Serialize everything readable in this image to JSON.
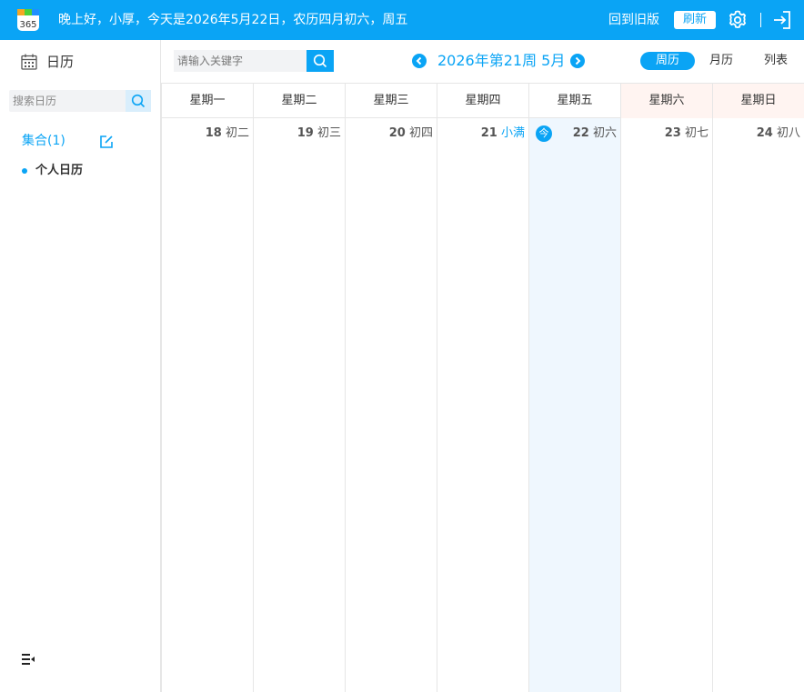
{
  "header": {
    "logo_text": "365",
    "greeting": "晚上好，小厚，今天是2026年5月22日，农历四月初六，周五",
    "old_version_link": "回到旧版",
    "refresh_button": "刷新"
  },
  "sidebar": {
    "title": "日历",
    "search_placeholder": "搜索日历",
    "collection_label": "集合(1)",
    "calendars": [
      {
        "name": "个人日历"
      }
    ]
  },
  "toolbar": {
    "search_placeholder": "请输入关键字",
    "period_title": "2026年第21周 5月",
    "views": {
      "week": "周历",
      "month": "月历",
      "list": "列表"
    },
    "active_view": "week"
  },
  "calendar": {
    "weekdays": [
      "星期一",
      "星期二",
      "星期三",
      "星期四",
      "星期五",
      "星期六",
      "星期日"
    ],
    "days": [
      {
        "day": "18",
        "lunar": "初二"
      },
      {
        "day": "19",
        "lunar": "初三"
      },
      {
        "day": "20",
        "lunar": "初四"
      },
      {
        "day": "21",
        "lunar": "小满",
        "solar_term": true
      },
      {
        "day": "22",
        "lunar": "初六",
        "today": true
      },
      {
        "day": "23",
        "lunar": "初七"
      },
      {
        "day": "24",
        "lunar": "初八"
      }
    ],
    "today_badge": "今"
  },
  "colors": {
    "accent": "#0aa4f5",
    "today_bg": "#eff7fe",
    "weekend_header_bg": "#fff4f1",
    "grid_line": "#e6e6e6"
  }
}
